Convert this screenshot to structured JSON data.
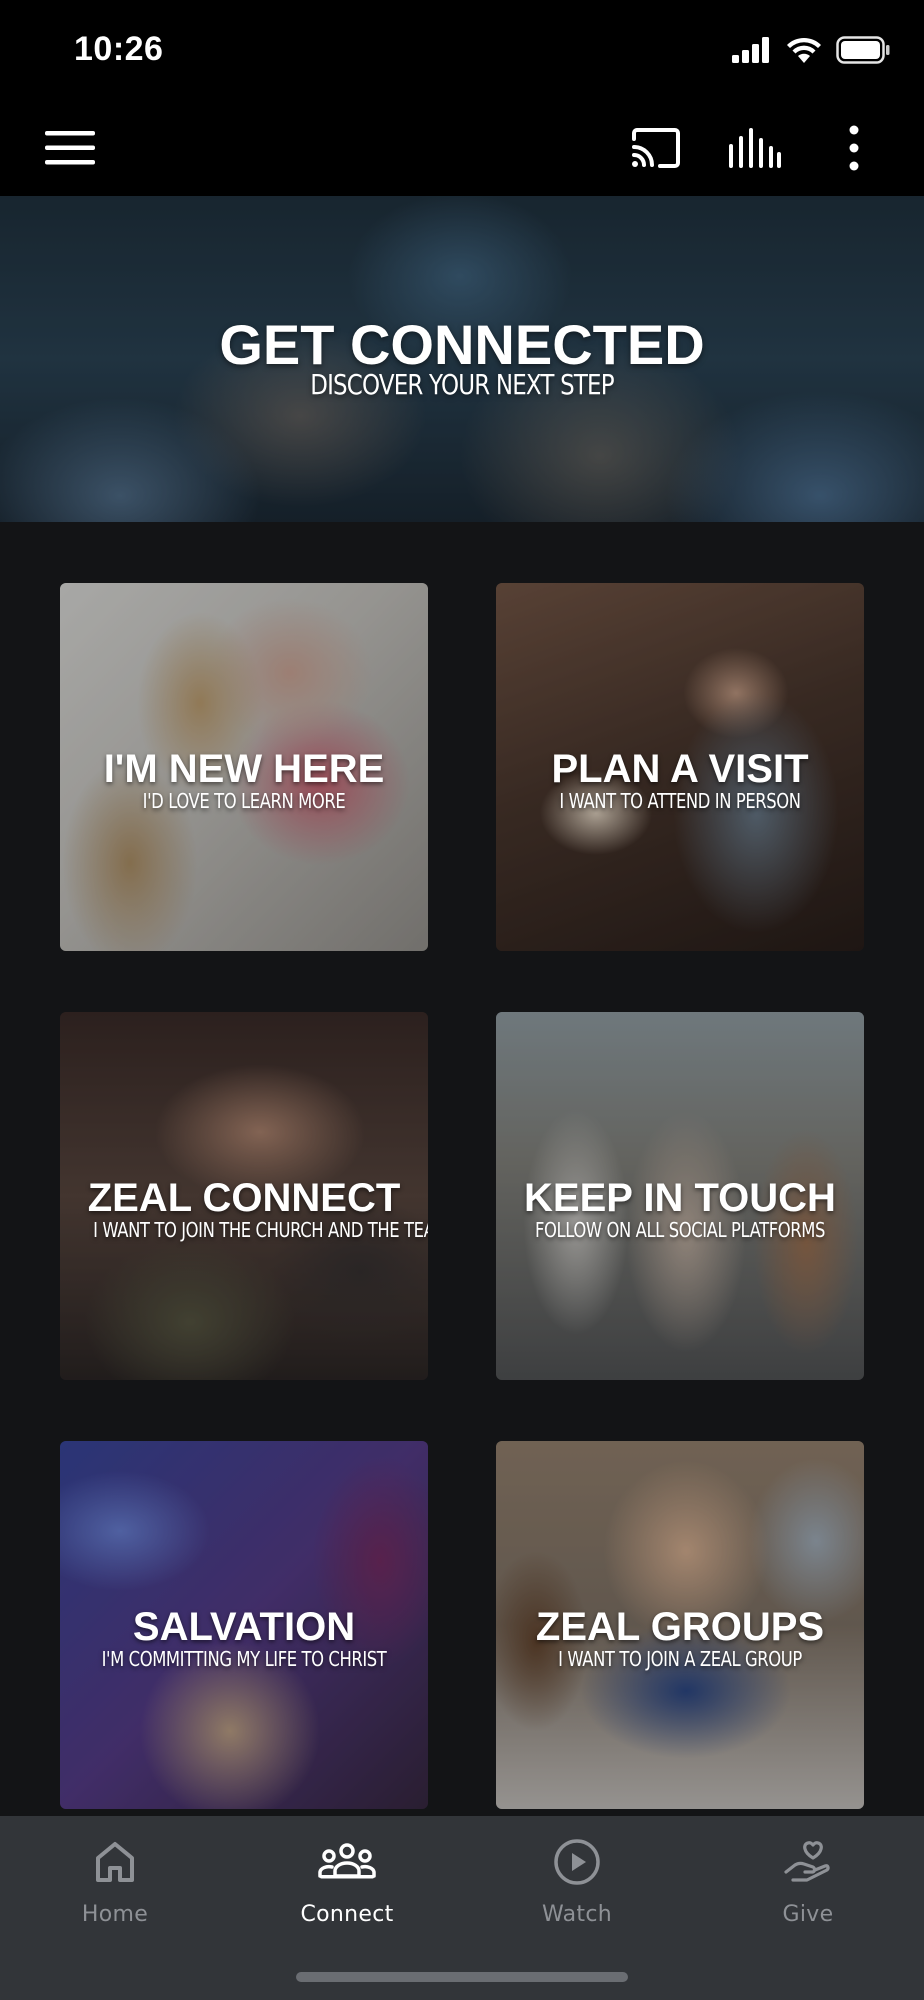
{
  "status_bar": {
    "time": "10:26"
  },
  "app_bar": {
    "icons": [
      "menu-icon",
      "cast-icon",
      "audio-bars-icon",
      "more-vertical-icon"
    ]
  },
  "hero": {
    "title": "GET CONNECTED",
    "subtitle": "DISCOVER YOUR NEXT STEP"
  },
  "cards": [
    {
      "title": "I'M NEW HERE",
      "subtitle": "I'D LOVE TO LEARN MORE"
    },
    {
      "title": "PLAN A VISIT",
      "subtitle": "I WANT TO ATTEND IN PERSON"
    },
    {
      "title": "ZEAL CONNECT",
      "subtitle": "I WANT TO JOIN THE CHURCH AND THE TEAM"
    },
    {
      "title": "KEEP IN TOUCH",
      "subtitle": "FOLLOW ON ALL SOCIAL PLATFORMS"
    },
    {
      "title": "SALVATION",
      "subtitle": "I'M COMMITTING MY LIFE TO CHRIST"
    },
    {
      "title": "ZEAL GROUPS",
      "subtitle": "I WANT TO JOIN A ZEAL GROUP"
    }
  ],
  "bottom_nav": {
    "items": [
      {
        "label": "Home",
        "icon": "home-icon",
        "active": false
      },
      {
        "label": "Connect",
        "icon": "people-icon",
        "active": true
      },
      {
        "label": "Watch",
        "icon": "play-circle-icon",
        "active": false
      },
      {
        "label": "Give",
        "icon": "heart-hand-icon",
        "active": false
      }
    ]
  },
  "colors": {
    "background": "#131416",
    "bar_background": "#000000",
    "nav_background": "#323539",
    "nav_active": "#ffffff",
    "nav_inactive": "#8e9196"
  }
}
